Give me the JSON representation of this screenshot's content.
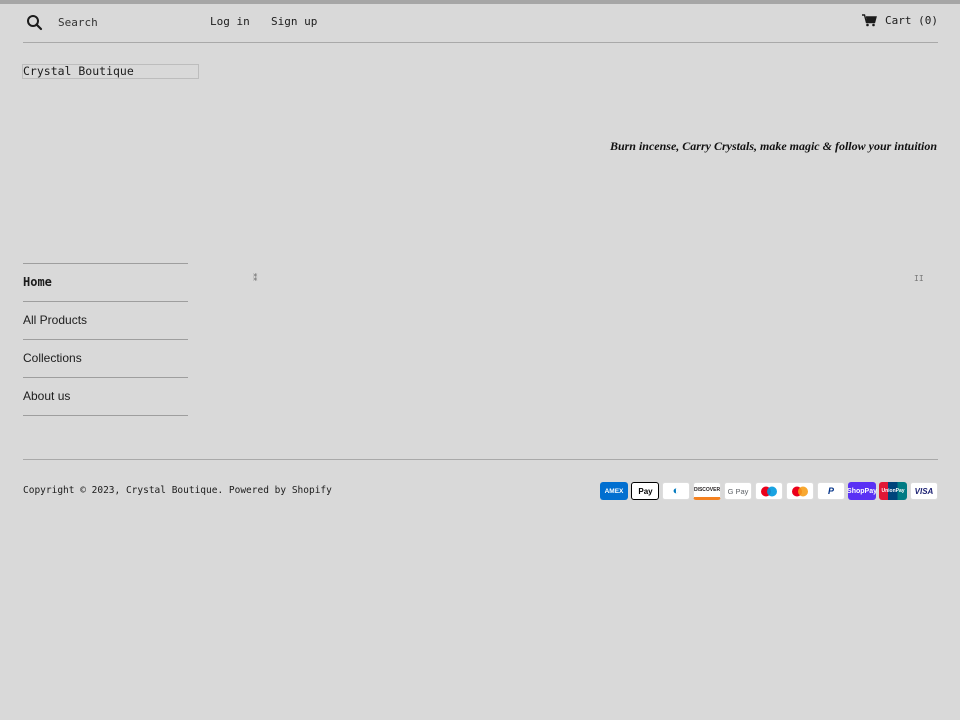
{
  "header": {
    "search_placeholder": "Search",
    "login_label": "Log in",
    "signup_label": "Sign up",
    "cart_label": "Cart (0)"
  },
  "store": {
    "name": "Crystal Boutique",
    "tagline": "Burn incense, Carry Crystals, make magic & follow your intuition"
  },
  "sidebar": {
    "items": [
      {
        "label": "Home",
        "active": true
      },
      {
        "label": "All Products"
      },
      {
        "label": "Collections"
      },
      {
        "label": "About us"
      }
    ]
  },
  "slideshow": {
    "prev_glyph": "⁑",
    "pause_glyph": "II"
  },
  "footer": {
    "copyright": "Copyright © 2023, Crystal Boutique. Powered by Shopify",
    "payment_methods": [
      {
        "name": "American Express",
        "text": "AMEX",
        "bg": "#016fd0",
        "fg": "#ffffff"
      },
      {
        "name": "Apple Pay",
        "text": "Pay",
        "bg": "#ffffff",
        "fg": "#000000"
      },
      {
        "name": "Diners Club",
        "text": "◐",
        "bg": "#ffffff",
        "fg": "#0079be"
      },
      {
        "name": "Discover",
        "text": "DISCOVER",
        "bg": "#ffffff",
        "fg": "#231f20"
      },
      {
        "name": "Google Pay",
        "text": "G Pay",
        "bg": "#ffffff",
        "fg": "#5f6368"
      },
      {
        "name": "Maestro",
        "text": "●●",
        "bg": "#ffffff",
        "fg": "#0099df"
      },
      {
        "name": "Mastercard",
        "text": "●●",
        "bg": "#ffffff",
        "fg": "#eb001b"
      },
      {
        "name": "PayPal",
        "text": "P",
        "bg": "#ffffff",
        "fg": "#003087"
      },
      {
        "name": "Shop Pay",
        "text": "ShopPay",
        "bg": "#5a31f4",
        "fg": "#ffffff"
      },
      {
        "name": "UnionPay",
        "text": "UnionPay",
        "bg": "#00999e",
        "fg": "#ffffff"
      },
      {
        "name": "Visa",
        "text": "VISA",
        "bg": "#ffffff",
        "fg": "#1a1f71"
      }
    ]
  }
}
